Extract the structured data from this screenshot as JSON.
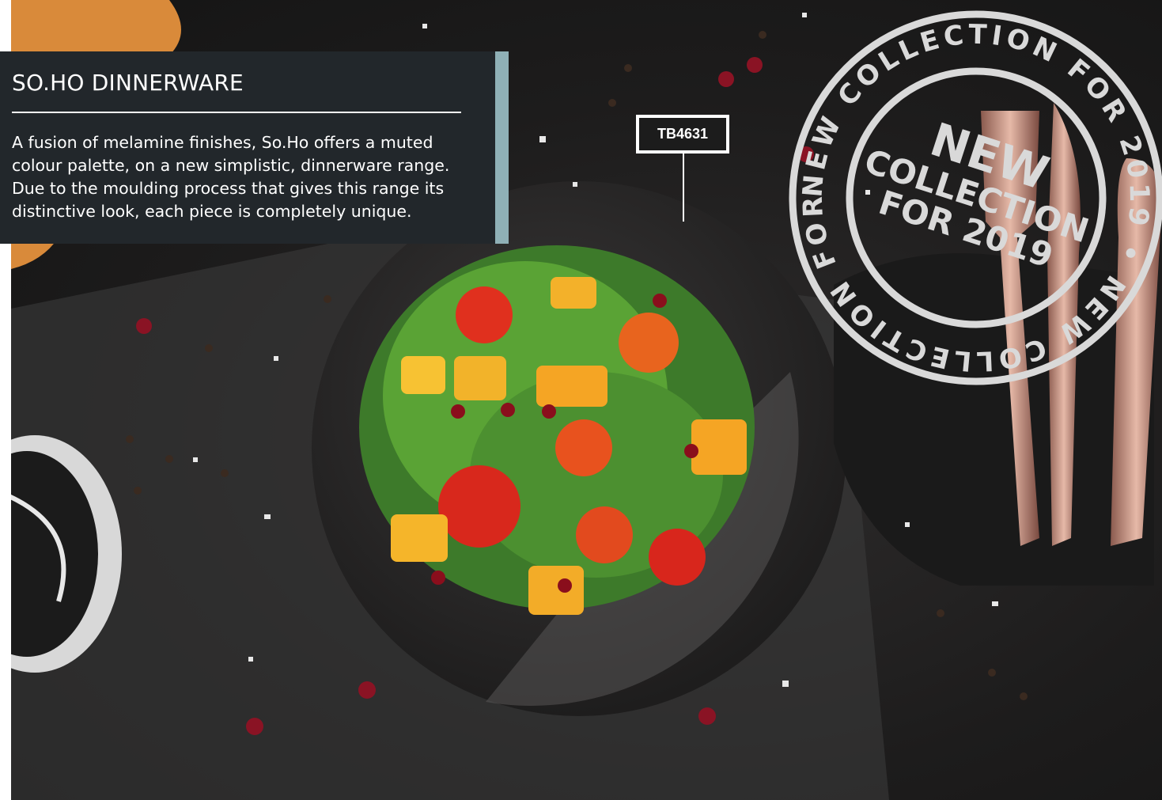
{
  "info": {
    "title": "SO.HO DINNERWARE",
    "description": "A fusion of melamine finishes, So.Ho offers a muted colour palette, on a new simplistic, dinnerware range. Due to the moulding process that gives this range its distinctive look, each piece is completely unique."
  },
  "product_code": "TB4631",
  "stamp": {
    "outer_ring_text": "NEW COLLECTION FOR 2019 • NEW COLLECTION FOR 2019 •",
    "center_line1": "NEW",
    "center_line2": "COLLECTION",
    "center_line3": "FOR 2019"
  },
  "colors": {
    "panel": "#22272b",
    "accent": "#8fb0b6",
    "stamp": "#d9d9d9"
  }
}
